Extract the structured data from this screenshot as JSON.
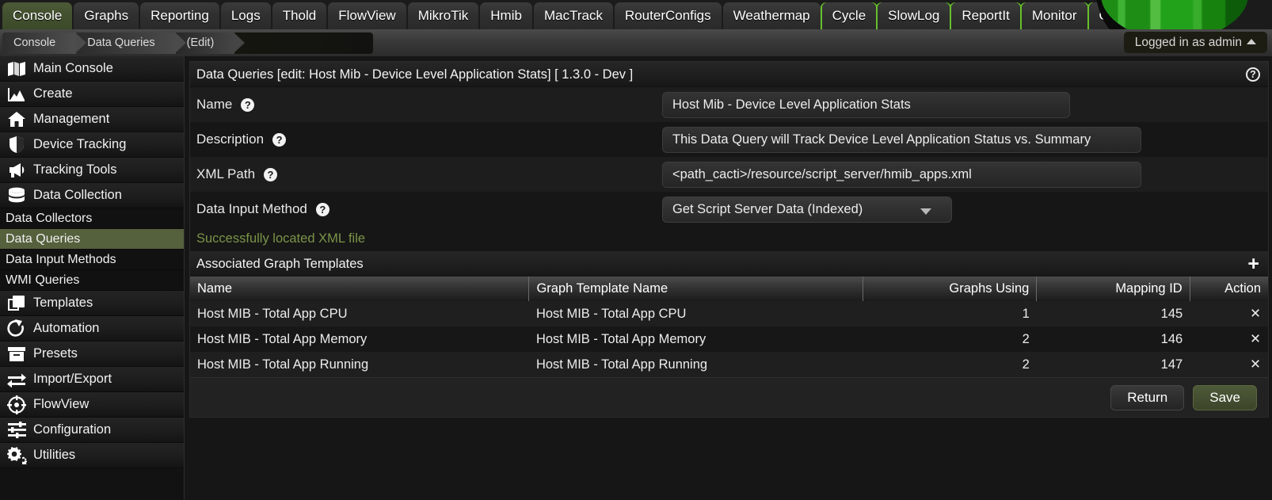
{
  "tabs": [
    {
      "label": "Console",
      "active": true,
      "greenline": false
    },
    {
      "label": "Graphs",
      "active": false,
      "greenline": false
    },
    {
      "label": "Reporting",
      "active": false,
      "greenline": false
    },
    {
      "label": "Logs",
      "active": false,
      "greenline": false
    },
    {
      "label": "Thold",
      "active": false,
      "greenline": false
    },
    {
      "label": "FlowView",
      "active": false,
      "greenline": false
    },
    {
      "label": "MikroTik",
      "active": false,
      "greenline": false
    },
    {
      "label": "Hmib",
      "active": false,
      "greenline": false
    },
    {
      "label": "MacTrack",
      "active": false,
      "greenline": false
    },
    {
      "label": "RouterConfigs",
      "active": false,
      "greenline": false
    },
    {
      "label": "Weathermap",
      "active": false,
      "greenline": false
    },
    {
      "label": "Cycle",
      "active": false,
      "greenline": true
    },
    {
      "label": "SlowLog",
      "active": false,
      "greenline": true
    },
    {
      "label": "ReportIt",
      "active": false,
      "greenline": true
    },
    {
      "label": "Monitor",
      "active": false,
      "greenline": true
    },
    {
      "label": "CFP",
      "active": false,
      "greenline": true
    }
  ],
  "breadcrumb": {
    "items": [
      "Console",
      "Data Queries",
      "(Edit)"
    ]
  },
  "user": {
    "status": "Logged in as admin",
    "caret_icon": "caret-up-icon"
  },
  "sidebar": {
    "groups": [
      {
        "label": "Main Console",
        "icon": "map-icon"
      },
      {
        "label": "Create",
        "icon": "chart-area-icon"
      },
      {
        "label": "Management",
        "icon": "home-icon"
      },
      {
        "label": "Device Tracking",
        "icon": "shield-icon"
      },
      {
        "label": "Tracking Tools",
        "icon": "megaphone-icon"
      },
      {
        "label": "Data Collection",
        "icon": "database-icon"
      }
    ],
    "subitems": [
      {
        "label": "Data Collectors",
        "selected": false
      },
      {
        "label": "Data Queries",
        "selected": true
      },
      {
        "label": "Data Input Methods",
        "selected": false
      },
      {
        "label": "WMI Queries",
        "selected": false
      }
    ],
    "groups2": [
      {
        "label": "Templates",
        "icon": "copy-icon"
      },
      {
        "label": "Automation",
        "icon": "circle-arrow-icon"
      },
      {
        "label": "Presets",
        "icon": "archive-box-icon"
      },
      {
        "label": "Import/Export",
        "icon": "exchange-arrows-icon"
      },
      {
        "label": "FlowView",
        "icon": "crosshair-icon"
      },
      {
        "label": "Configuration",
        "icon": "sliders-icon"
      },
      {
        "label": "Utilities",
        "icon": "gears-icon"
      }
    ],
    "selected_color": "#55603c"
  },
  "panel": {
    "title": "Data Queries [edit: Host Mib - Device Level Application Stats] [ 1.3.0 - Dev ]",
    "help_icon": "question-circle-icon"
  },
  "form": {
    "fields": [
      {
        "label": "Name",
        "value": "Host Mib - Device Level Application Stats",
        "help": "?"
      },
      {
        "label": "Description",
        "value": "This Data Query will Track Device Level Application Status vs. Summary",
        "help": "?"
      },
      {
        "label": "XML Path",
        "value": "<path_cacti>/resource/script_server/hmib_apps.xml",
        "help": "?"
      }
    ],
    "data_input_method": {
      "label": "Data Input Method",
      "help": "?",
      "selected": "Get Script Server Data (Indexed)",
      "dropdown_icon": "chevron-down-icon"
    }
  },
  "status_message": "Successfully located XML file",
  "associated": {
    "heading": "Associated Graph Templates",
    "add_icon": "plus-icon",
    "add_label": "+",
    "columns": [
      "Name",
      "Graph Template Name",
      "Graphs Using",
      "Mapping ID",
      "Action"
    ],
    "rows": [
      {
        "name": "Host MIB - Total App CPU",
        "graph_template_name": "Host MIB - Total App CPU",
        "graphs_using": "1",
        "mapping_id": "145",
        "action_icon": "remove-x-icon",
        "action": "✕"
      },
      {
        "name": "Host MIB - Total App Memory",
        "graph_template_name": "Host MIB - Total App Memory",
        "graphs_using": "2",
        "mapping_id": "146",
        "action_icon": "remove-x-icon",
        "action": "✕"
      },
      {
        "name": "Host MIB - Total App Running",
        "graph_template_name": "Host MIB - Total App Running",
        "graphs_using": "2",
        "mapping_id": "147",
        "action_icon": "remove-x-icon",
        "action": "✕"
      }
    ]
  },
  "buttons": {
    "return_label": "Return",
    "save_label": "Save"
  },
  "colors": {
    "accent_green": "#67c02c",
    "selected_olive": "#55603c",
    "link_green": "#7d9450",
    "status_green": "#7a9447"
  }
}
